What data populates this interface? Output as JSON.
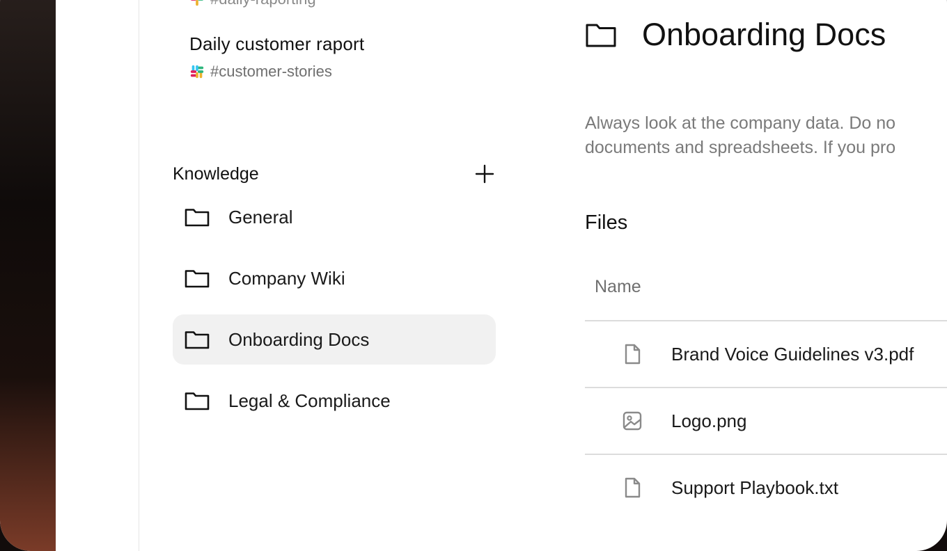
{
  "sidebar": {
    "channels": [
      {
        "title": "",
        "channel": "#daily-raporting"
      },
      {
        "title": "Daily customer raport",
        "channel": "#customer-stories"
      }
    ],
    "knowledge": {
      "title": "Knowledge",
      "items": [
        {
          "label": "General",
          "active": false
        },
        {
          "label": "Company Wiki",
          "active": false
        },
        {
          "label": "Onboarding Docs",
          "active": true
        },
        {
          "label": "Legal & Compliance",
          "active": false
        }
      ]
    }
  },
  "main": {
    "title": "Onboarding Docs",
    "description_lines": [
      "Always look at the company data. Do no",
      "documents and spreadsheets. If you pro"
    ],
    "files_title": "Files",
    "table": {
      "name_header": "Name",
      "rows": [
        {
          "name": "Brand Voice Guidelines v3.pdf",
          "icon": "file-icon"
        },
        {
          "name": "Logo.png",
          "icon": "image-icon"
        },
        {
          "name": "Support Playbook.txt",
          "icon": "file-icon"
        }
      ]
    }
  },
  "colors": {
    "active_bg": "#f1f1f1",
    "text_primary": "#111111",
    "text_muted": "#7a7a7a"
  }
}
